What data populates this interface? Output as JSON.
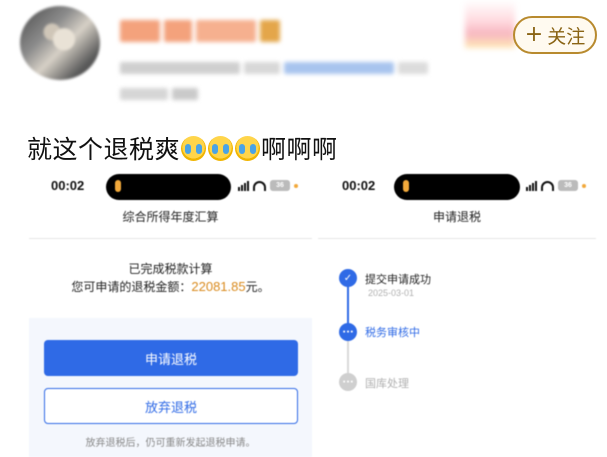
{
  "post": {
    "follow_plus": "+",
    "follow_label": "关注",
    "text": "就这个退税爽",
    "text_tail": "啊啊啊"
  },
  "left_phone": {
    "time": "00:02",
    "battery": "36",
    "title": "综合所得年度汇算",
    "calc_done": "已完成税款计算",
    "refund_label": "您可申请的退税金额：",
    "refund_amount": "22081.85",
    "refund_unit": "元。",
    "apply_button": "申请退税",
    "abandon_button": "放弃退税",
    "note": "放弃退税后，仍可重新发起退税申请。"
  },
  "right_phone": {
    "time": "00:02",
    "battery": "36",
    "title": "申请退税",
    "steps": [
      {
        "label": "提交申请成功",
        "date": "2025-03-01",
        "state": "done"
      },
      {
        "label": "税务审核中",
        "state": "current"
      },
      {
        "label": "国库处理",
        "state": "pending"
      }
    ]
  },
  "colors": {
    "primary": "#2f6ae6",
    "amount": "#d98a1c",
    "follow_border": "#b88a2e"
  }
}
